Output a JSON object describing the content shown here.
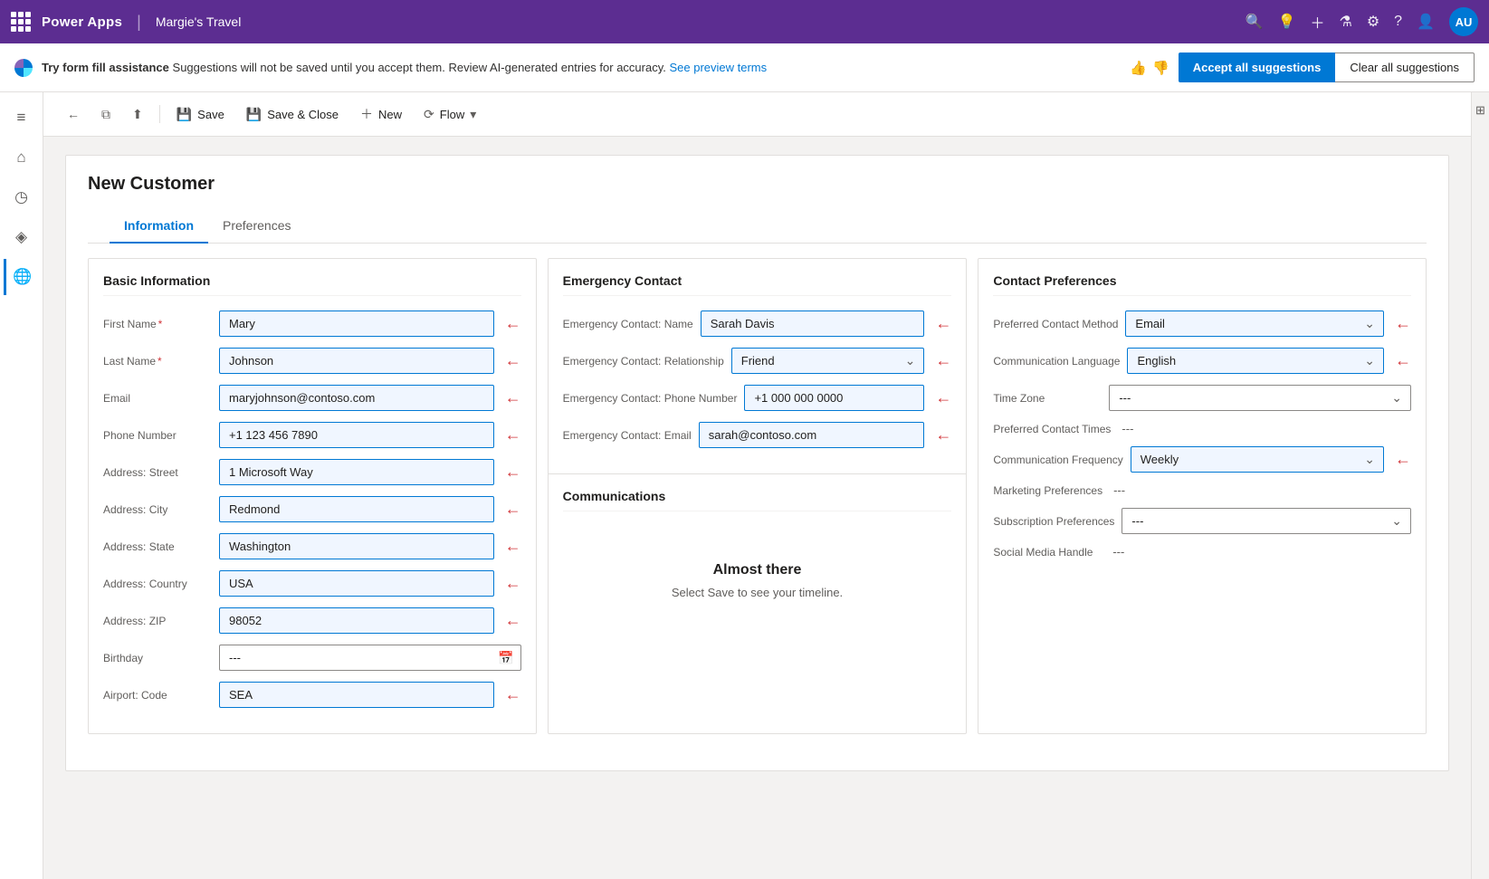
{
  "appName": "Power Apps",
  "tenantName": "Margie's Travel",
  "avatar": "AU",
  "banner": {
    "bold": "Try form fill assistance",
    "text": " Suggestions will not be saved until you accept them. Review AI-generated entries for accuracy.",
    "link": "See preview terms",
    "acceptBtn": "Accept all suggestions",
    "clearBtn": "Clear all suggestions"
  },
  "toolbar": {
    "backLabel": "",
    "saveLabel": "Save",
    "saveCloseLabel": "Save & Close",
    "newLabel": "New",
    "flowLabel": "Flow"
  },
  "form": {
    "title": "New Customer",
    "tabs": [
      "Information",
      "Preferences"
    ],
    "activeTab": "Information"
  },
  "basicInfo": {
    "title": "Basic Information",
    "fields": [
      {
        "label": "First Name",
        "required": true,
        "value": "Mary",
        "type": "input",
        "highlighted": true
      },
      {
        "label": "Last Name",
        "required": true,
        "value": "Johnson",
        "type": "input",
        "highlighted": true
      },
      {
        "label": "Email",
        "required": false,
        "value": "maryjohnson@contoso.com",
        "type": "input",
        "highlighted": true
      },
      {
        "label": "Phone Number",
        "required": false,
        "value": "+1 123 456 7890",
        "type": "input",
        "highlighted": true
      },
      {
        "label": "Address: Street",
        "required": false,
        "value": "1 Microsoft Way",
        "type": "input",
        "highlighted": true
      },
      {
        "label": "Address: City",
        "required": false,
        "value": "Redmond",
        "type": "input",
        "highlighted": true
      },
      {
        "label": "Address: State",
        "required": false,
        "value": "Washington",
        "type": "input",
        "highlighted": true
      },
      {
        "label": "Address: Country",
        "required": false,
        "value": "USA",
        "type": "input",
        "highlighted": true
      },
      {
        "label": "Address: ZIP",
        "required": false,
        "value": "98052",
        "type": "input",
        "highlighted": true
      },
      {
        "label": "Birthday",
        "required": false,
        "value": "---",
        "type": "date",
        "highlighted": false
      },
      {
        "label": "Airport: Code",
        "required": false,
        "value": "SEA",
        "type": "input",
        "highlighted": true
      }
    ]
  },
  "emergencyContact": {
    "title": "Emergency Contact",
    "fields": [
      {
        "label": "Emergency Contact: Name",
        "value": "Sarah Davis",
        "type": "input",
        "highlighted": true
      },
      {
        "label": "Emergency Contact: Relationship",
        "value": "Friend",
        "type": "select",
        "highlighted": true
      },
      {
        "label": "Emergency Contact: Phone Number",
        "value": "+1 000 000 0000",
        "type": "input",
        "highlighted": true
      },
      {
        "label": "Emergency Contact: Email",
        "value": "sarah@contoso.com",
        "type": "input",
        "highlighted": true
      }
    ],
    "communications": {
      "title": "Communications",
      "almostThereTitle": "Almost there",
      "almostThereText": "Select Save to see your timeline."
    }
  },
  "contactPreferences": {
    "title": "Contact Preferences",
    "fields": [
      {
        "label": "Preferred Contact Method",
        "value": "Email",
        "type": "select",
        "highlighted": true
      },
      {
        "label": "Communication Language",
        "value": "English",
        "type": "select",
        "highlighted": true
      },
      {
        "label": "Time Zone",
        "value": "---",
        "type": "select",
        "highlighted": false
      },
      {
        "label": "Preferred Contact Times",
        "value": "---",
        "type": "text",
        "highlighted": false
      },
      {
        "label": "Communication Frequency",
        "value": "Weekly",
        "type": "select",
        "highlighted": true
      },
      {
        "label": "Marketing Preferences",
        "value": "---",
        "type": "text",
        "highlighted": false
      },
      {
        "label": "Subscription Preferences",
        "value": "---",
        "type": "select",
        "highlighted": false
      },
      {
        "label": "Social Media Handle",
        "value": "---",
        "type": "text",
        "highlighted": false
      }
    ]
  },
  "sidebar": {
    "icons": [
      {
        "name": "home-icon",
        "symbol": "⌂"
      },
      {
        "name": "clock-icon",
        "symbol": "◷"
      },
      {
        "name": "pin-icon",
        "symbol": "📌"
      },
      {
        "name": "globe-icon",
        "symbol": "🌐"
      }
    ]
  }
}
